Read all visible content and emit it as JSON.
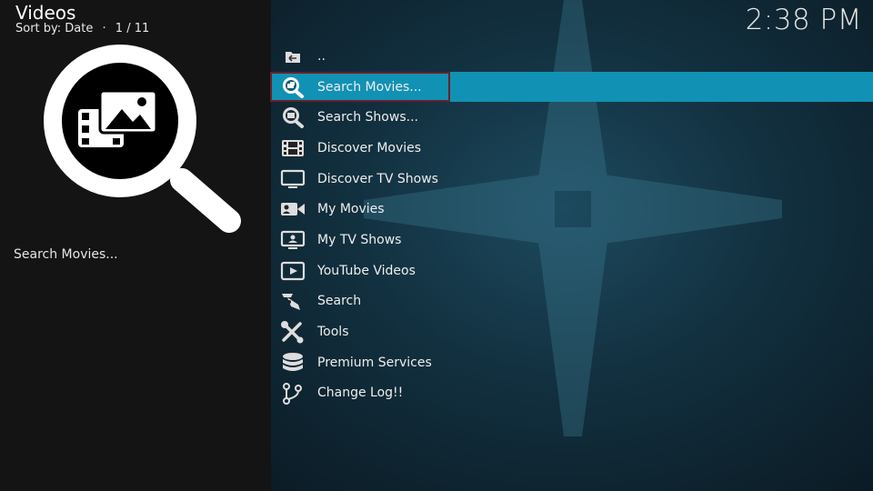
{
  "header": {
    "title": "Videos",
    "sort_label": "Sort by: Date",
    "separator": "·",
    "position": "1 / 11"
  },
  "clock": "2:38 PM",
  "focused_item_label": "Search Movies...",
  "list": {
    "items": [
      {
        "label": "..",
        "icon": "folder-back-icon"
      },
      {
        "label": "Search Movies...",
        "icon": "search-movies-icon",
        "focused": true
      },
      {
        "label": "Search Shows...",
        "icon": "search-shows-icon"
      },
      {
        "label": "Discover Movies",
        "icon": "film-strip-icon"
      },
      {
        "label": "Discover TV Shows",
        "icon": "tv-icon"
      },
      {
        "label": "My Movies",
        "icon": "video-camera-icon"
      },
      {
        "label": "My TV Shows",
        "icon": "tv-user-icon"
      },
      {
        "label": "YouTube Videos",
        "icon": "play-button-icon"
      },
      {
        "label": "Search",
        "icon": "search-tool-icon"
      },
      {
        "label": "Tools",
        "icon": "tools-icon"
      },
      {
        "label": "Premium Services",
        "icon": "coins-icon"
      },
      {
        "label": "Change Log!!",
        "icon": "git-branch-icon"
      }
    ]
  },
  "colors": {
    "focus_bar": "#1191b4",
    "focus_outline": "#6a1f2a",
    "left_panel": "#141414"
  }
}
